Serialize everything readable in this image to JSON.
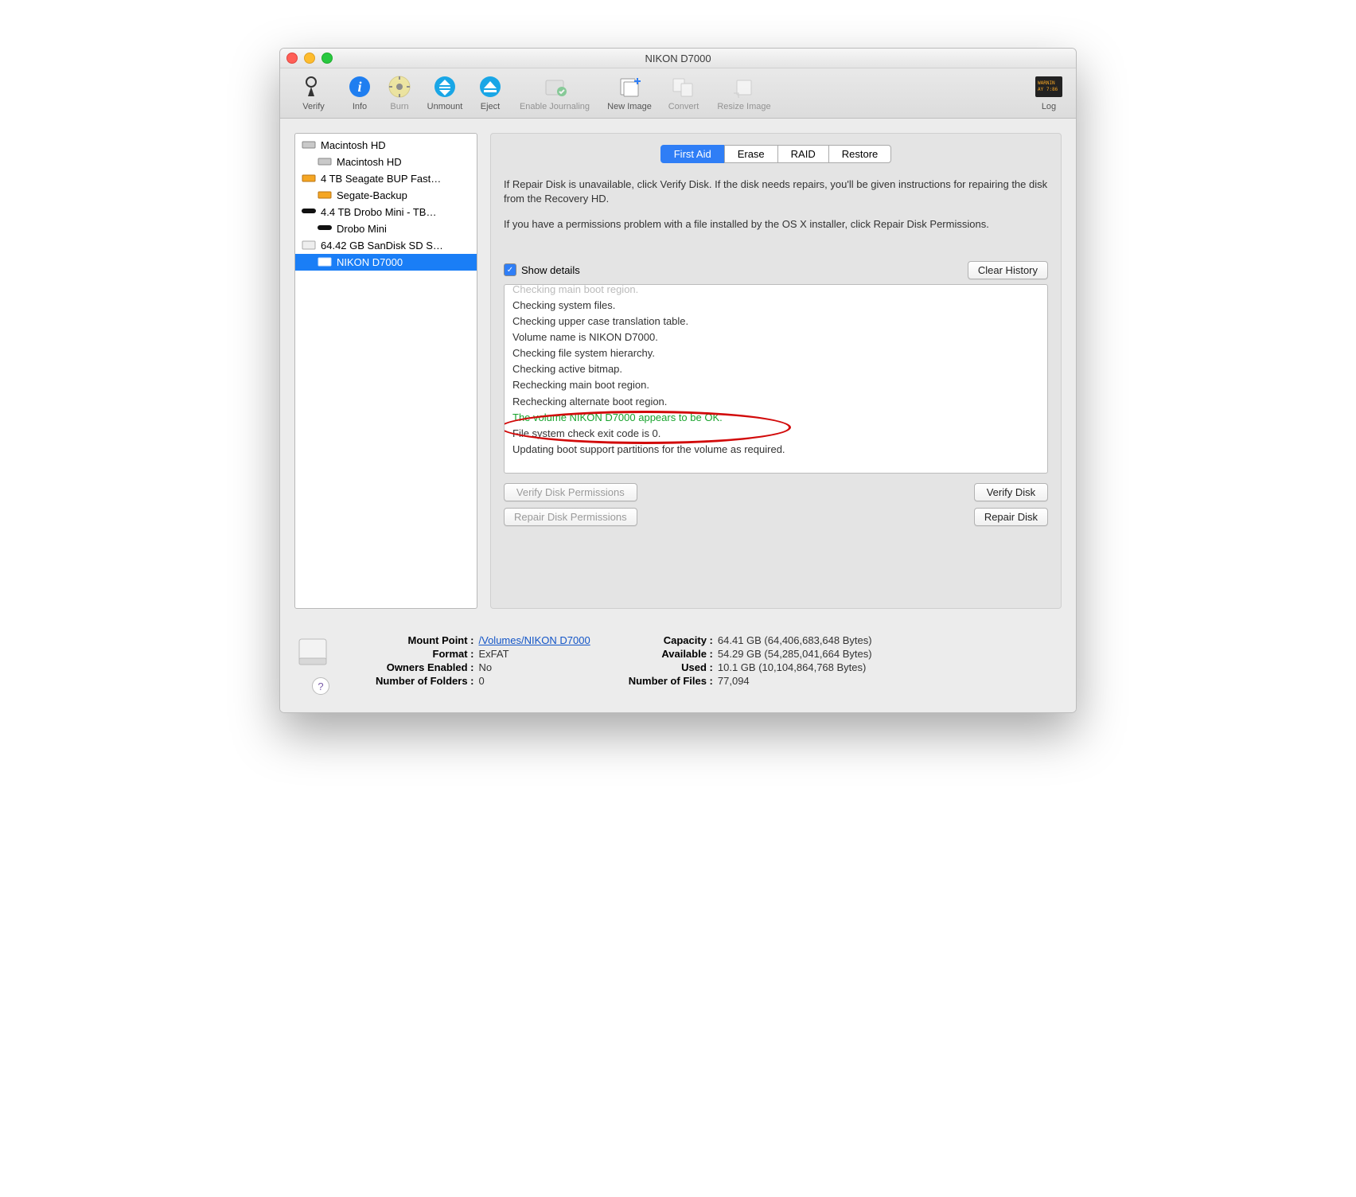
{
  "window": {
    "title": "NIKON D7000"
  },
  "toolbar": {
    "verify": "Verify",
    "info": "Info",
    "burn": "Burn",
    "unmount": "Unmount",
    "eject": "Eject",
    "enable_journaling": "Enable Journaling",
    "new_image": "New Image",
    "convert": "Convert",
    "resize_image": "Resize Image",
    "log": "Log"
  },
  "sidebar": {
    "items": [
      {
        "label": "Macintosh HD",
        "type": "disk"
      },
      {
        "label": "Macintosh HD",
        "type": "vol"
      },
      {
        "label": "4 TB Seagate BUP Fast…",
        "type": "disk-orange"
      },
      {
        "label": "Segate-Backup",
        "type": "vol-orange"
      },
      {
        "label": "4.4 TB Drobo Mini - TB…",
        "type": "black"
      },
      {
        "label": "Drobo Mini",
        "type": "black-sm"
      },
      {
        "label": "64.42 GB SanDisk SD S…",
        "type": "drive"
      },
      {
        "label": "NIKON D7000",
        "type": "drive-sel"
      }
    ]
  },
  "tabs": {
    "first_aid": "First Aid",
    "erase": "Erase",
    "raid": "RAID",
    "restore": "Restore"
  },
  "instructions": {
    "p1": "If Repair Disk is unavailable, click Verify Disk. If the disk needs repairs, you'll be given instructions for repairing the disk from the Recovery HD.",
    "p2": "If you have a permissions problem with a file installed by the OS X installer, click Repair Disk Permissions."
  },
  "details": {
    "show_details": "Show details",
    "clear_history": "Clear History"
  },
  "log": {
    "l0": "Checking main boot region.",
    "l1": "Checking system files.",
    "l2": "Checking upper case translation table.",
    "l3": "Volume name is NIKON D7000.",
    "l4": "Checking file system hierarchy.",
    "l5": "Checking active bitmap.",
    "l6": "Rechecking main boot region.",
    "l7": "Rechecking alternate boot region.",
    "l8": "The volume NIKON D7000 appears to be OK.",
    "l9": "File system check exit code is 0.",
    "l10": "Updating boot support partitions for the volume as required."
  },
  "buttons": {
    "verify_perm": "Verify Disk Permissions",
    "repair_perm": "Repair Disk Permissions",
    "verify_disk": "Verify Disk",
    "repair_disk": "Repair Disk"
  },
  "footer": {
    "mount_point_label": "Mount Point :",
    "mount_point": "/Volumes/NIKON D7000",
    "format_label": "Format :",
    "format": "ExFAT",
    "owners_label": "Owners Enabled :",
    "owners": "No",
    "folders_label": "Number of Folders :",
    "folders": "0",
    "capacity_label": "Capacity :",
    "capacity": "64.41 GB (64,406,683,648 Bytes)",
    "available_label": "Available :",
    "available": "54.29 GB (54,285,041,664 Bytes)",
    "used_label": "Used :",
    "used": "10.1 GB (10,104,864,768 Bytes)",
    "files_label": "Number of Files :",
    "files": "77,094"
  }
}
